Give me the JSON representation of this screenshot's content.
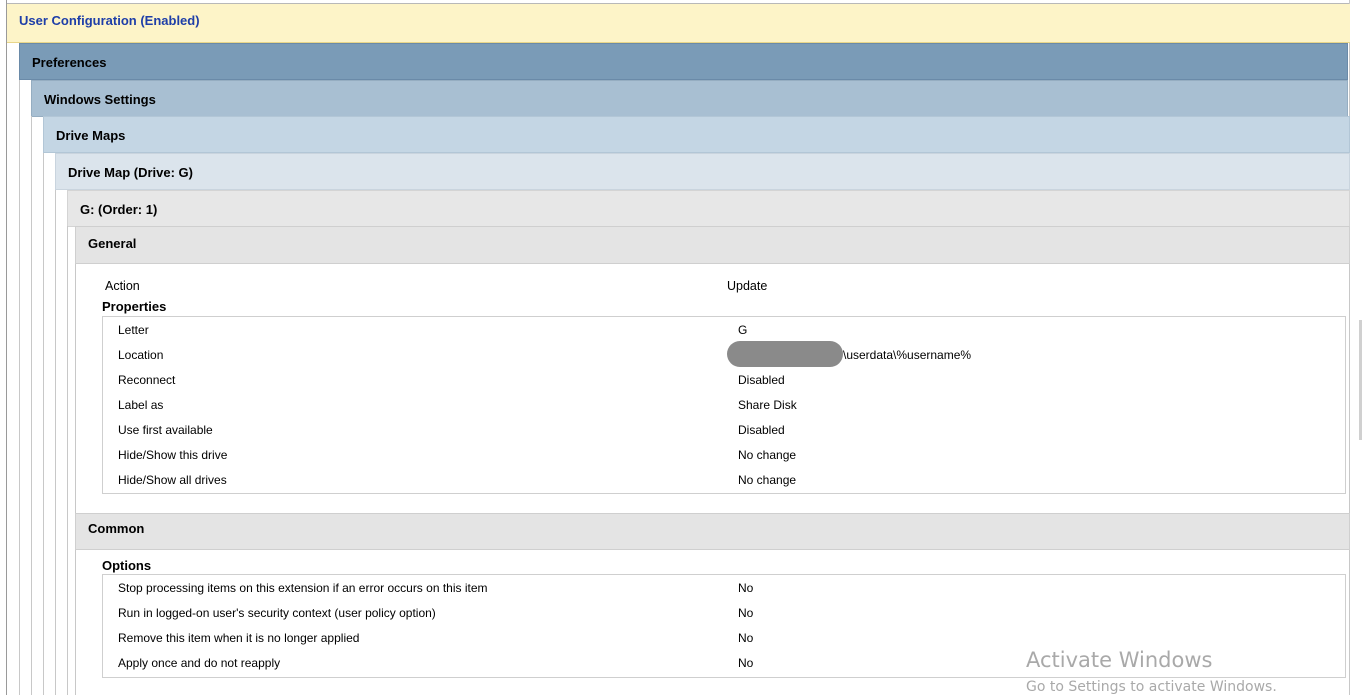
{
  "headers": {
    "user_configuration": "User Configuration (Enabled)",
    "preferences": "Preferences",
    "windows_settings": "Windows Settings",
    "drive_maps": "Drive Maps",
    "drive_map": "Drive Map (Drive: G)",
    "order": "G: (Order: 1)",
    "general": "General",
    "common": "Common"
  },
  "general": {
    "action_label": "Action",
    "action_value": "Update",
    "properties_title": "Properties",
    "properties": [
      {
        "label": "Letter",
        "value": "G"
      },
      {
        "label": "Location",
        "value": "\\userdata\\%username%"
      },
      {
        "label": "Reconnect",
        "value": "Disabled"
      },
      {
        "label": "Label as",
        "value": "Share Disk"
      },
      {
        "label": "Use first available",
        "value": "Disabled"
      },
      {
        "label": "Hide/Show this drive",
        "value": "No change"
      },
      {
        "label": "Hide/Show all drives",
        "value": "No change"
      }
    ]
  },
  "common": {
    "options_title": "Options",
    "options": [
      {
        "label": "Stop processing items on this extension if an error occurs on this item",
        "value": "No"
      },
      {
        "label": "Run in logged-on user's security context (user policy option)",
        "value": "No"
      },
      {
        "label": "Remove this item when it is no longer applied",
        "value": "No"
      },
      {
        "label": "Apply once and do not reapply",
        "value": "No"
      }
    ]
  },
  "watermark": {
    "line1": "Activate Windows",
    "line2": "Go to Settings to activate Windows."
  }
}
